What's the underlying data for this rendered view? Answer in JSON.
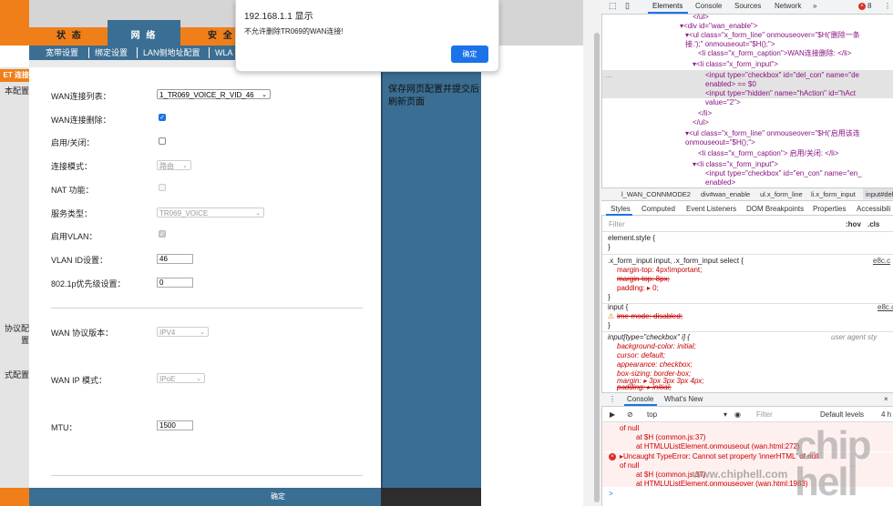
{
  "router": {
    "nav_tabs": [
      "状 态",
      "网 络",
      "安 全"
    ],
    "sub_nav": [
      "宽带设置",
      "绑定设置",
      "LAN侧地址配置",
      "WLA"
    ],
    "sidebar_active": "ET 连接",
    "sidebar_labels": [
      "本配置",
      "协议配置",
      "式配置"
    ],
    "form": {
      "wan_list_label": "WAN连接列表：",
      "wan_list_value": "1_TR069_VOICE_R_VID_46",
      "wan_delete_label": "WAN连接删除：",
      "enable_label": "启用/关闭：",
      "conn_mode_label": "连接模式：",
      "conn_mode_value": "路由",
      "nat_label": "NAT 功能：",
      "service_label": "服务类型：",
      "service_value": "TR069_VOICE",
      "vlan_enable_label": "启用VLAN：",
      "vlan_id_label": "VLAN ID设置：",
      "vlan_id_value": "46",
      "priority_label": "802.1p优先级设置：",
      "priority_value": "0",
      "wan_proto_label": "WAN 协议版本：",
      "wan_proto_value": "IPV4",
      "wan_ip_mode_label": "WAN IP 模式：",
      "wan_ip_mode_value": "IPoE",
      "mtu_label": "MTU：",
      "mtu_value": "1500"
    },
    "help_text": "保存网页配置并提交后刷新页面",
    "confirm_label": "确定"
  },
  "alert": {
    "title": "192.168.1.1 显示",
    "message": "不允许删除TR069的WAN连接!",
    "ok_label": "确定"
  },
  "devtools": {
    "tabs": [
      "Elements",
      "Console",
      "Sources",
      "Network",
      "»"
    ],
    "error_count": "8",
    "elements_lines": [
      "</ul>",
      "<div id=\"wan_enable\">",
      "<ul class=\"x_form_line\" onmouseover=\"$H('删除一条",
      "接.');\" onmouseout=\"$H();\">",
      "<li class=\"x_form_caption\">WAN连接删除: </li>",
      "<li class=\"x_form_input\">",
      "<input type=\"checkbox\" id=\"del_con\" name=\"de",
      "enabled> == $0",
      "<input type=\"hidden\" name=\"hAction\" id=\"hAct",
      "value=\"2\">",
      "</li>",
      "</ul>",
      "<ul class=\"x_form_line\" onmouseover=\"$H('启用该连",
      "onmouseout=\"$H();\">",
      "<li class=\"x_form_caption\"> 启用/关闭: </li>",
      "<li class=\"x_form_input\">",
      "<input type=\"checkbox\" id=\"en_con\" name=\"en_",
      "enabled>"
    ],
    "breadcrumbs": [
      "l_WAN_CONNMODE2",
      "div#wan_enable",
      "ul.x_form_line",
      "li.x_form_input",
      "input#del"
    ],
    "subtabs": [
      "Styles",
      "Computed",
      "Event Listeners",
      "DOM Breakpoints",
      "Properties",
      "Accessibili"
    ],
    "filter_placeholder": "Filter",
    "hov_label": ":hov",
    "cls_label": ".cls",
    "style_lines": [
      "element.style {",
      "}",
      ".x_form_input input, .x_form_input select {",
      "margin-top: 4px!important;",
      "margin-top: 8px;",
      "padding: ▸ 0;",
      "}",
      "input {",
      "ime-mode: disabled;",
      "}",
      "input[type=\"checkbox\" i] {",
      "background-color: initial;",
      "cursor: default;",
      "appearance: checkbox;",
      "box-sizing: border-box;",
      "margin: ▸ 3px 3px 3px 4px;",
      "padding: ▸ initial;"
    ],
    "style_sources": [
      "e8c.c",
      "e8c.c",
      "user agent sty"
    ],
    "console_tabs": [
      "Console",
      "What's New"
    ],
    "console_context": "top",
    "console_filter": "Filter",
    "console_levels": "Default levels",
    "console_count": "4 h",
    "console_lines": [
      "of null",
      "at $H (common.js:37)",
      "at HTMLUListElement.onmouseout (wan.html:272)",
      "▸Uncaught TypeError: Cannot set property 'innerHTML' of null",
      "of null",
      "at $H (common.js:37)",
      "at HTMLUListElement.onmouseover (wan.html:1983)"
    ],
    "console_prompt": ">"
  },
  "watermark": {
    "logo": "chip hell",
    "url": "www.chiphell.com"
  }
}
